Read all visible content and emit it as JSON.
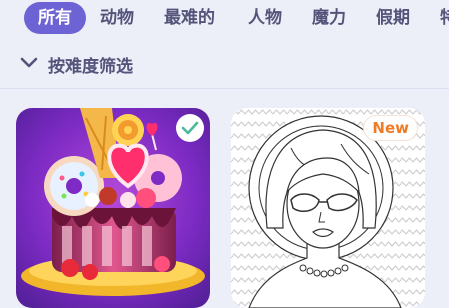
{
  "tabs": [
    {
      "label": "所有",
      "active": true
    },
    {
      "label": "动物",
      "active": false
    },
    {
      "label": "最难的",
      "active": false
    },
    {
      "label": "人物",
      "active": false
    },
    {
      "label": "魔力",
      "active": false
    },
    {
      "label": "假期",
      "active": false
    },
    {
      "label": "特",
      "active": false
    }
  ],
  "filter": {
    "label": "按难度筛选",
    "icon": "chevron-down-icon"
  },
  "cards": [
    {
      "badge_icon": "check-icon",
      "completed": true
    },
    {
      "badge": "New"
    }
  ],
  "colors": {
    "accent": "#6d63d5",
    "tab_text": "#54547a",
    "background": "#eceef8",
    "new_badge": "#f07a25",
    "check": "#4bb89a"
  }
}
